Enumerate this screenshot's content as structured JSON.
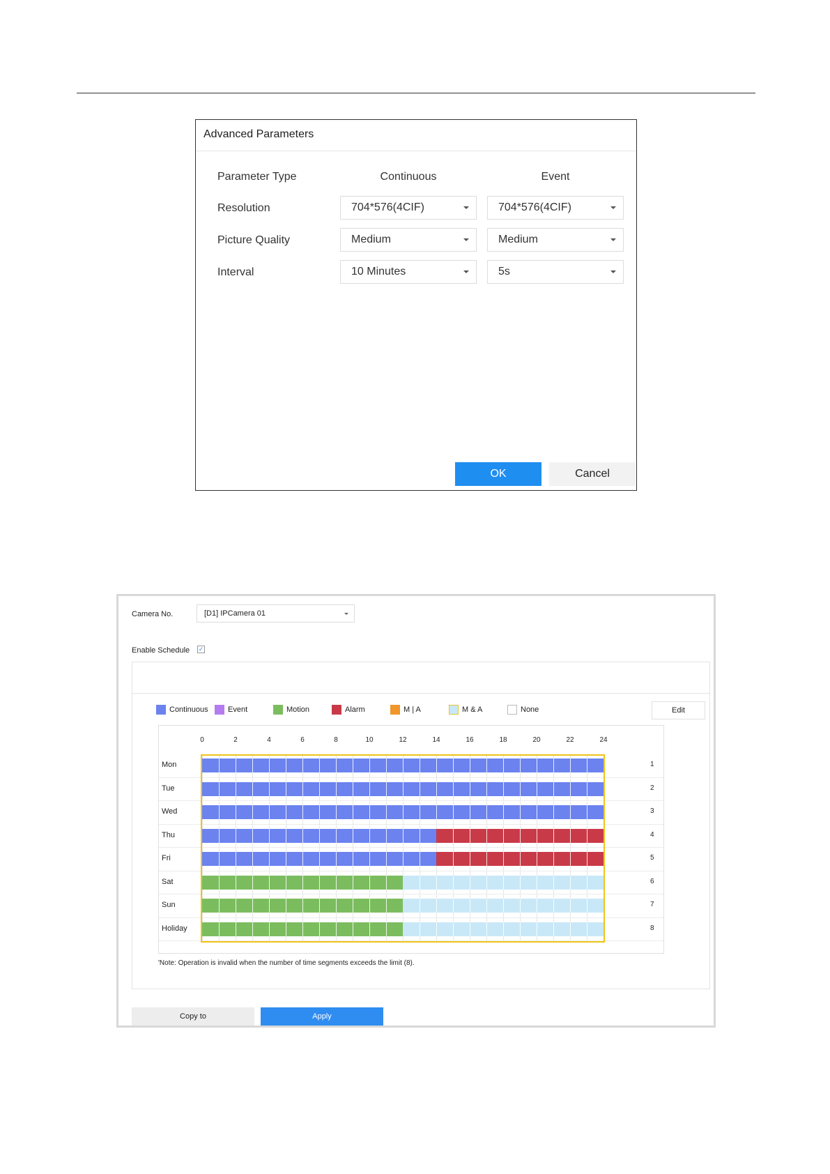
{
  "dialog": {
    "title": "Advanced Parameters",
    "col_label": "Parameter Type",
    "col_continuous": "Continuous",
    "col_event": "Event",
    "rows": [
      {
        "label": "Resolution",
        "continuous": "704*576(4CIF)",
        "event": "704*576(4CIF)"
      },
      {
        "label": "Picture Quality",
        "continuous": "Medium",
        "event": "Medium"
      },
      {
        "label": "Interval",
        "continuous": "10 Minutes",
        "event": "5s"
      }
    ],
    "ok_label": "OK",
    "cancel_label": "Cancel"
  },
  "schedule": {
    "camera_label": "Camera No.",
    "camera_value": "[D1] IPCamera 01",
    "enable_label": "Enable Schedule",
    "enable_checked": true,
    "legend": [
      {
        "label": "Continuous",
        "color": "#6b82ef"
      },
      {
        "label": "Event",
        "color": "#b57bf0"
      },
      {
        "label": "Motion",
        "color": "#7bbd5e"
      },
      {
        "label": "Alarm",
        "color": "#c93a48"
      },
      {
        "label": "M | A",
        "color": "#f0962a"
      },
      {
        "label": "M & A",
        "color": "#c8e8f8"
      },
      {
        "label": "None",
        "color": "#ffffff"
      }
    ],
    "edit_label": "Edit",
    "hours": [
      "0",
      "2",
      "4",
      "6",
      "8",
      "10",
      "12",
      "14",
      "16",
      "18",
      "20",
      "22",
      "24"
    ],
    "days": [
      {
        "label": "Mon",
        "count": "1",
        "segments": [
          {
            "start": 0,
            "end": 24,
            "type": "Continuous"
          }
        ]
      },
      {
        "label": "Tue",
        "count": "2",
        "segments": [
          {
            "start": 0,
            "end": 24,
            "type": "Continuous"
          }
        ]
      },
      {
        "label": "Wed",
        "count": "3",
        "segments": [
          {
            "start": 0,
            "end": 24,
            "type": "Continuous"
          }
        ]
      },
      {
        "label": "Thu",
        "count": "4",
        "segments": [
          {
            "start": 0,
            "end": 14,
            "type": "Continuous"
          },
          {
            "start": 14,
            "end": 24,
            "type": "Alarm"
          }
        ]
      },
      {
        "label": "Fri",
        "count": "5",
        "segments": [
          {
            "start": 0,
            "end": 14,
            "type": "Continuous"
          },
          {
            "start": 14,
            "end": 24,
            "type": "Alarm"
          }
        ]
      },
      {
        "label": "Sat",
        "count": "6",
        "segments": [
          {
            "start": 0,
            "end": 12,
            "type": "Motion"
          },
          {
            "start": 12,
            "end": 24,
            "type": "M & A"
          }
        ]
      },
      {
        "label": "Sun",
        "count": "7",
        "segments": [
          {
            "start": 0,
            "end": 12,
            "type": "Motion"
          },
          {
            "start": 12,
            "end": 24,
            "type": "M & A"
          }
        ]
      },
      {
        "label": "Holiday",
        "count": "8",
        "segments": [
          {
            "start": 0,
            "end": 12,
            "type": "Motion"
          },
          {
            "start": 12,
            "end": 24,
            "type": "M & A"
          }
        ]
      }
    ],
    "note": "'Note: Operation is invalid when the number of time segments exceeds the limit (8).",
    "copy_label": "Copy to",
    "apply_label": "Apply"
  }
}
